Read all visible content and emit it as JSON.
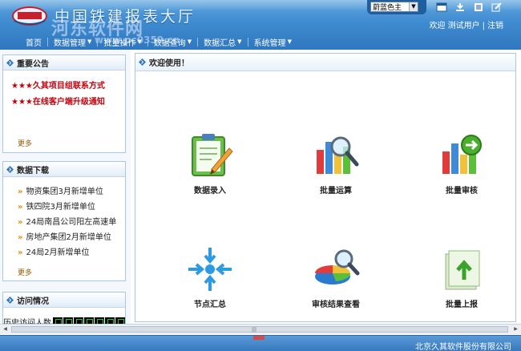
{
  "header": {
    "title": "中国铁建报表大厅",
    "watermark_text": "河东软件网",
    "watermark_url": "www.pc0359.cn",
    "theme_selected": "蔚蓝色主",
    "welcome_text": "欢迎 测试用户",
    "welcome_sep": "|",
    "logout_label": "注销",
    "icons": [
      "window-icon",
      "download-icon",
      "list-icon",
      "edit-icon"
    ]
  },
  "nav": {
    "items": [
      {
        "label": "首页"
      },
      {
        "label": "数据管理"
      },
      {
        "label": "批量操作"
      },
      {
        "label": "数据查询"
      },
      {
        "label": "数据汇总"
      },
      {
        "label": "系统管理"
      }
    ]
  },
  "notices": {
    "title": "重要公告",
    "items": [
      {
        "stars": "★★★",
        "text": "久其项目组联系方式"
      },
      {
        "stars": "★★★",
        "text": "在线客户端升级通知"
      }
    ],
    "more": "更多"
  },
  "downloads": {
    "title": "数据下载",
    "items": [
      {
        "text": "物资集团3月新增单位"
      },
      {
        "text": "铁四院3月新增单位"
      },
      {
        "text": "24局南昌公司阳左高速单"
      },
      {
        "text": "房地产集团2月新增单位"
      },
      {
        "text": "24局2月新增单位"
      }
    ],
    "more": "更多"
  },
  "visits": {
    "title": "访问情况",
    "history_label": "历史访问人数"
  },
  "main": {
    "title": "欢迎使用！",
    "functions": [
      {
        "label": "数据录入"
      },
      {
        "label": "批量运算"
      },
      {
        "label": "批量审核"
      },
      {
        "label": "节点汇总"
      },
      {
        "label": "审核结果查看"
      },
      {
        "label": "批量上报"
      }
    ]
  },
  "footer": {
    "copyright": "北京久其软件股份有限公司"
  },
  "colors": {
    "header_blue": "#3f8bd0",
    "notice_red": "#c6000b",
    "panel_border": "#a9c6e4"
  }
}
